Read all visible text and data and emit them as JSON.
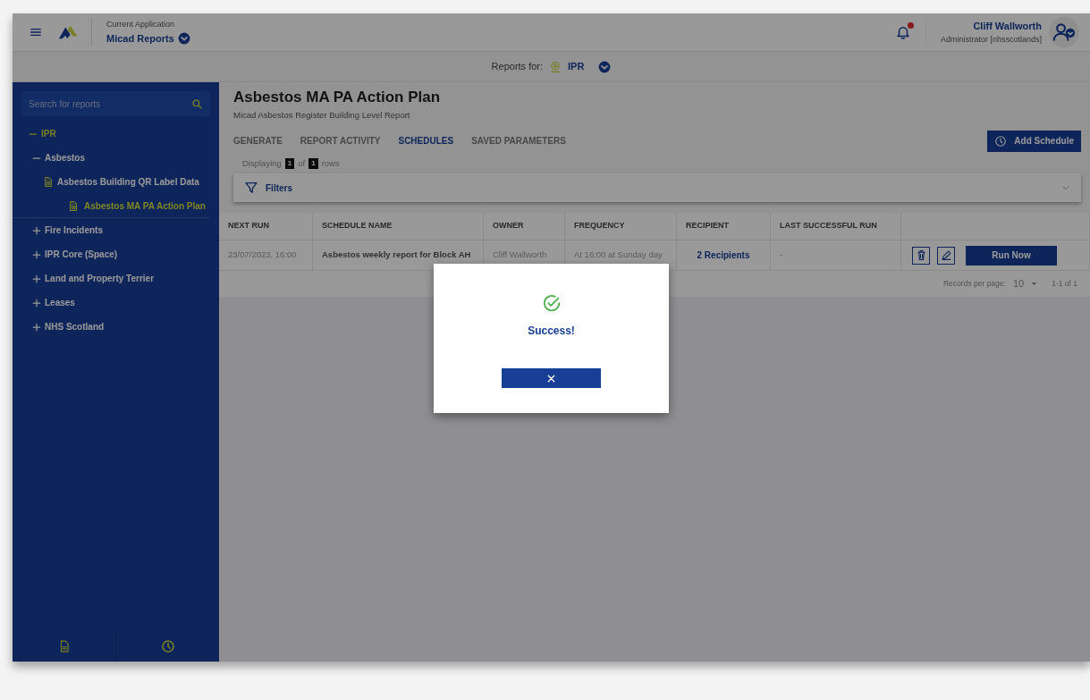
{
  "header": {
    "app_label": "Current Application",
    "app_name": "Micad Reports",
    "notification": {
      "unread": true
    },
    "user_name": "Cliff Wallworth",
    "user_role": "Administrator [nhsscotlands]"
  },
  "reports_for": {
    "label": "Reports for:",
    "value": "IPR"
  },
  "sidebar": {
    "search": {
      "placeholder": "Search for reports"
    },
    "tree": [
      {
        "label": "IPR",
        "expanded": true,
        "children": [
          {
            "label": "Asbestos",
            "expanded": true,
            "children": [
              {
                "label": "Asbestos Building QR Label Data",
                "kind": "report",
                "selected": false
              },
              {
                "label": "Asbestos MA PA Action Plan",
                "kind": "report",
                "selected": true
              }
            ]
          },
          {
            "label": "Fire Incidents",
            "expanded": false
          },
          {
            "label": "IPR Core (Space)",
            "expanded": false
          },
          {
            "label": "Land and Property Terrier",
            "expanded": false
          },
          {
            "label": "Leases",
            "expanded": false
          },
          {
            "label": "NHS Scotland",
            "expanded": false
          }
        ]
      }
    ]
  },
  "page": {
    "title": "Asbestos MA PA Action Plan",
    "subtitle": "Micad Asbestos Register Building Level Report",
    "tabs": [
      {
        "label": "GENERATE",
        "selected": false
      },
      {
        "label": "REPORT ACTIVITY",
        "selected": false
      },
      {
        "label": "SCHEDULES",
        "selected": true
      },
      {
        "label": "SAVED PARAMETERS",
        "selected": false
      }
    ],
    "add_button": "Add Schedule",
    "displaying": {
      "prefix": "Displaying",
      "shown": "1",
      "of": "of",
      "total": "1",
      "suffix": "rows"
    },
    "filters": "Filters",
    "table": {
      "columns": [
        "NEXT RUN",
        "SCHEDULE NAME",
        "OWNER",
        "FREQUENCY",
        "RECIPIENT",
        "LAST SUCCESSFUL RUN"
      ],
      "rows": [
        {
          "next_run": "23/07/2023, 16:00",
          "name": "Asbestos weekly report for Block AH",
          "owner": "Cliff Wallworth",
          "frequency": "At 16:00 at Sunday day",
          "recipient": "2 Recipients",
          "last_run": "-",
          "run_button": "Run Now"
        }
      ]
    },
    "pagination": {
      "label": "Records per page:",
      "per_page": "10",
      "range": "1-1 of 1"
    }
  },
  "modal": {
    "message": "Success!"
  }
}
